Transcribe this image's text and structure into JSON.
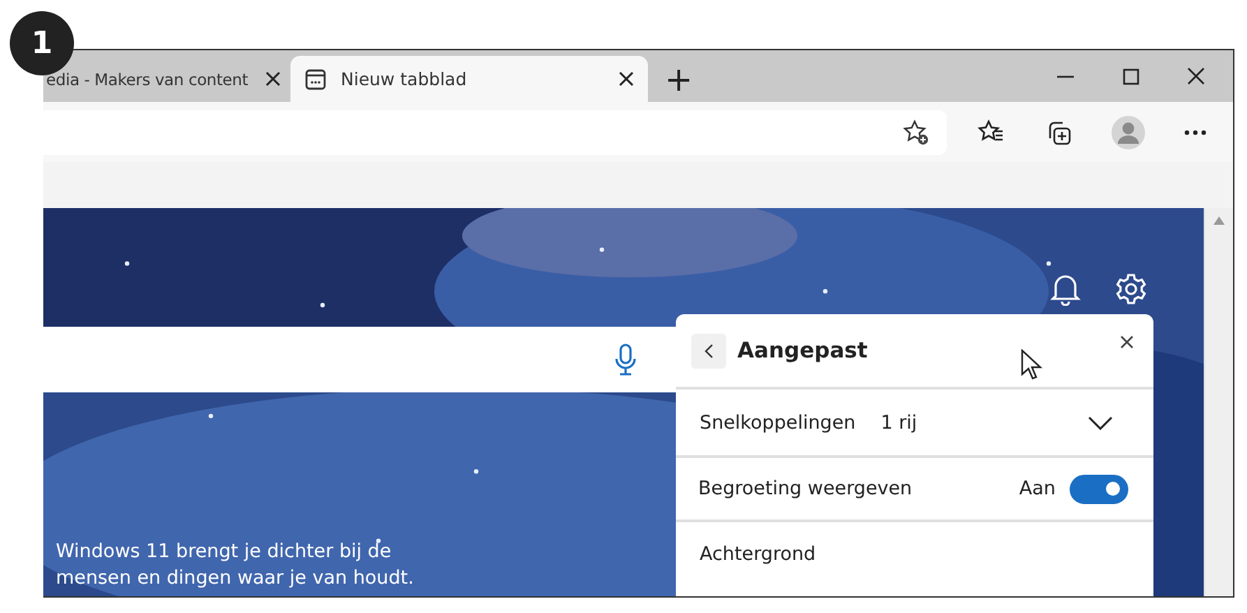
{
  "badge": "1",
  "tabs": [
    {
      "title": "edia - Makers van content",
      "selected": false
    },
    {
      "title": "Nieuw tabblad",
      "selected": true
    }
  ],
  "new_tab": "+",
  "caption": "Windows 11 brengt je dichter bij de mensen en dingen waar je van houdt.",
  "panel": {
    "title": "Aangepast",
    "rows": [
      {
        "kind": "dropdown",
        "label": "Snelkoppelingen",
        "value": "1 rij"
      },
      {
        "kind": "toggle",
        "label": "Begroeting weergeven",
        "value": "Aan",
        "on": true
      },
      {
        "kind": "heading",
        "label": "Achtergrond"
      }
    ]
  }
}
